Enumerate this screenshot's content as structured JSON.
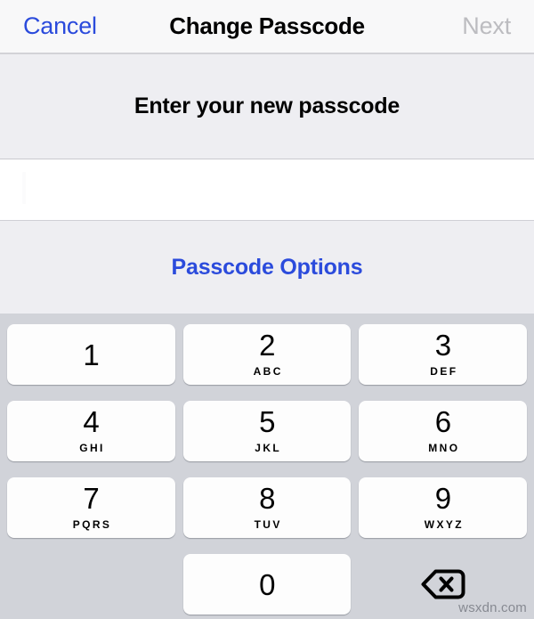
{
  "navbar": {
    "cancel_label": "Cancel",
    "title": "Change Passcode",
    "next_label": "Next",
    "cancel_color": "#2b4bdc",
    "next_color": "#bcbcc0"
  },
  "prompt": {
    "text": "Enter your new passcode"
  },
  "entry": {
    "value": "",
    "caret_visible": "true"
  },
  "options": {
    "label": "Passcode Options",
    "color": "#2b4bdc"
  },
  "keypad": {
    "background_color": "#d1d3d9",
    "key_color": "#fdfdfd",
    "keys": [
      {
        "digit": "1",
        "letters": ""
      },
      {
        "digit": "2",
        "letters": "ABC"
      },
      {
        "digit": "3",
        "letters": "DEF"
      },
      {
        "digit": "4",
        "letters": "GHI"
      },
      {
        "digit": "5",
        "letters": "JKL"
      },
      {
        "digit": "6",
        "letters": "MNO"
      },
      {
        "digit": "7",
        "letters": "PQRS"
      },
      {
        "digit": "8",
        "letters": "TUV"
      },
      {
        "digit": "9",
        "letters": "WXYZ"
      },
      {
        "digit": "0",
        "letters": ""
      }
    ],
    "delete_icon": "backspace-icon"
  },
  "watermark": {
    "text": "wsxdn.com"
  }
}
